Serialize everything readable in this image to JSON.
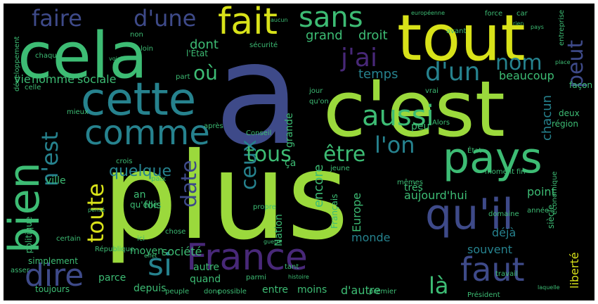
{
  "colors": {
    "background": "#000000",
    "lime": "#9bd93c",
    "green": "#3dbc74",
    "teal": "#26828e",
    "cyan": "#1f9e89",
    "blue": "#3e4a89",
    "purple": "#482878",
    "yellow": "#d8e219",
    "darkpurple": "#440154"
  },
  "words": [
    {
      "text": "plus",
      "color": "lime"
    },
    {
      "text": "a",
      "color": "blue"
    },
    {
      "text": "c'est",
      "color": "lime"
    },
    {
      "text": "tout",
      "color": "yellow"
    },
    {
      "text": "cela",
      "color": "green"
    },
    {
      "text": "bien",
      "color": "green"
    },
    {
      "text": "cette",
      "color": "teal"
    },
    {
      "text": "pays",
      "color": "green"
    },
    {
      "text": "qu'il",
      "color": "blue"
    },
    {
      "text": "France",
      "color": "purple"
    },
    {
      "text": "faut",
      "color": "blue"
    },
    {
      "text": "comme",
      "color": "teal"
    },
    {
      "text": "fait",
      "color": "yellow"
    },
    {
      "text": "aussi",
      "color": "green"
    },
    {
      "text": "dire",
      "color": "blue"
    },
    {
      "text": "sans",
      "color": "green"
    },
    {
      "text": "si",
      "color": "teal"
    },
    {
      "text": "faire",
      "color": "blue"
    },
    {
      "text": "d'une",
      "color": "blue"
    },
    {
      "text": "j'ai",
      "color": "purple"
    },
    {
      "text": "nom",
      "color": "teal"
    },
    {
      "text": "d'un",
      "color": "teal"
    },
    {
      "text": "peut",
      "color": "blue"
    },
    {
      "text": "n'est",
      "color": "teal"
    },
    {
      "text": "toute",
      "color": "yellow"
    },
    {
      "text": "ceux",
      "color": "teal"
    },
    {
      "text": "tous",
      "color": "green"
    },
    {
      "text": "être",
      "color": "green"
    },
    {
      "text": "l'on",
      "color": "teal"
    },
    {
      "text": "date",
      "color": "blue"
    },
    {
      "text": "quelque",
      "color": "teal"
    },
    {
      "text": "là",
      "color": "green"
    },
    {
      "text": "où",
      "color": "green"
    },
    {
      "text": "dont",
      "color": "green"
    },
    {
      "text": "temps",
      "color": "teal"
    },
    {
      "text": "droit",
      "color": "green"
    },
    {
      "text": "grand",
      "color": "green"
    },
    {
      "text": "beaucoup",
      "color": "green"
    },
    {
      "text": "chacun",
      "color": "teal"
    },
    {
      "text": "homme",
      "color": "green"
    },
    {
      "text": "sociale",
      "color": "green"
    },
    {
      "text": "vie",
      "color": "green"
    },
    {
      "text": "ville",
      "color": "green"
    },
    {
      "text": "encore",
      "color": "green"
    },
    {
      "text": "Europe",
      "color": "green"
    },
    {
      "text": "aujourd'hui",
      "color": "green"
    },
    {
      "text": "point",
      "color": "green"
    },
    {
      "text": "monde",
      "color": "teal"
    },
    {
      "text": "déjà",
      "color": "teal"
    },
    {
      "text": "souvent",
      "color": "teal"
    },
    {
      "text": "société",
      "color": "green"
    },
    {
      "text": "moyen",
      "color": "green"
    },
    {
      "text": "autre",
      "color": "green"
    },
    {
      "text": "quand",
      "color": "green"
    },
    {
      "text": "parce",
      "color": "green"
    },
    {
      "text": "depuis",
      "color": "green"
    },
    {
      "text": "entre",
      "color": "green"
    },
    {
      "text": "moins",
      "color": "green"
    },
    {
      "text": "d'autre",
      "color": "green"
    },
    {
      "text": "liberté",
      "color": "yellow"
    },
    {
      "text": "toujours",
      "color": "green"
    },
    {
      "text": "simplement",
      "color": "green"
    },
    {
      "text": "politique",
      "color": "green"
    },
    {
      "text": "Nation",
      "color": "green"
    },
    {
      "text": "très",
      "color": "green"
    },
    {
      "text": "grande",
      "color": "green"
    },
    {
      "text": "fois",
      "color": "green"
    },
    {
      "text": "an",
      "color": "green"
    },
    {
      "text": "ça",
      "color": "green"
    },
    {
      "text": "peu",
      "color": "green"
    },
    {
      "text": "qu'elle",
      "color": "green"
    },
    {
      "text": "l'État",
      "color": "green"
    },
    {
      "text": "chaque",
      "color": "green"
    },
    {
      "text": "loin",
      "color": "green"
    },
    {
      "text": "mieux",
      "color": "green"
    },
    {
      "text": "Conseil",
      "color": "green"
    },
    {
      "text": "qu'on",
      "color": "green"
    },
    {
      "text": "jour",
      "color": "green"
    },
    {
      "text": "vrai",
      "color": "green"
    },
    {
      "text": "deux",
      "color": "green"
    },
    {
      "text": "région",
      "color": "green"
    },
    {
      "text": "façon",
      "color": "green"
    },
    {
      "text": "avant",
      "color": "green"
    },
    {
      "text": "force",
      "color": "green"
    },
    {
      "text": "car",
      "color": "green"
    },
    {
      "text": "celle",
      "color": "green"
    },
    {
      "text": "non",
      "color": "green"
    },
    {
      "text": "part",
      "color": "green"
    },
    {
      "text": "après",
      "color": "green"
    },
    {
      "text": "siècle",
      "color": "green"
    },
    {
      "text": "Président",
      "color": "green"
    },
    {
      "text": "travail",
      "color": "green"
    },
    {
      "text": "peuple",
      "color": "green"
    },
    {
      "text": "possible",
      "color": "green"
    },
    {
      "text": "donc",
      "color": "green"
    },
    {
      "text": "premier",
      "color": "green"
    },
    {
      "text": "ici",
      "color": "green"
    },
    {
      "text": "Français",
      "color": "green"
    },
    {
      "text": "développement",
      "color": "green"
    },
    {
      "text": "sécurité",
      "color": "green"
    },
    {
      "text": "asser",
      "color": "green"
    },
    {
      "text": "moment",
      "color": "green"
    },
    {
      "text": "jeune",
      "color": "green"
    },
    {
      "text": "fin",
      "color": "green"
    },
    {
      "text": "certain",
      "color": "green"
    },
    {
      "text": "tant",
      "color": "green"
    },
    {
      "text": "parmi",
      "color": "green"
    },
    {
      "text": "République",
      "color": "green"
    },
    {
      "text": "État",
      "color": "green"
    },
    {
      "text": "Alors",
      "color": "green"
    },
    {
      "text": "mêmes",
      "color": "green"
    },
    {
      "text": "crois",
      "color": "green"
    },
    {
      "text": "paix",
      "color": "green"
    },
    {
      "text": "chose",
      "color": "green"
    },
    {
      "text": "année",
      "color": "green"
    },
    {
      "text": "domaine",
      "color": "green"
    },
    {
      "text": "économique",
      "color": "green"
    },
    {
      "text": "européenne",
      "color": "green"
    },
    {
      "text": "entreprise",
      "color": "green"
    },
    {
      "text": "place",
      "color": "green"
    },
    {
      "text": "rien",
      "color": "green"
    },
    {
      "text": "pays",
      "color": "green"
    },
    {
      "text": "propre",
      "color": "green"
    },
    {
      "text": "guerre",
      "color": "green"
    },
    {
      "text": "histoire",
      "color": "green"
    },
    {
      "text": "effet",
      "color": "green"
    },
    {
      "text": "pensé",
      "color": "green"
    },
    {
      "text": "aucun",
      "color": "green"
    },
    {
      "text": "voie",
      "color": "green"
    },
    {
      "text": "laquelle",
      "color": "green"
    }
  ]
}
